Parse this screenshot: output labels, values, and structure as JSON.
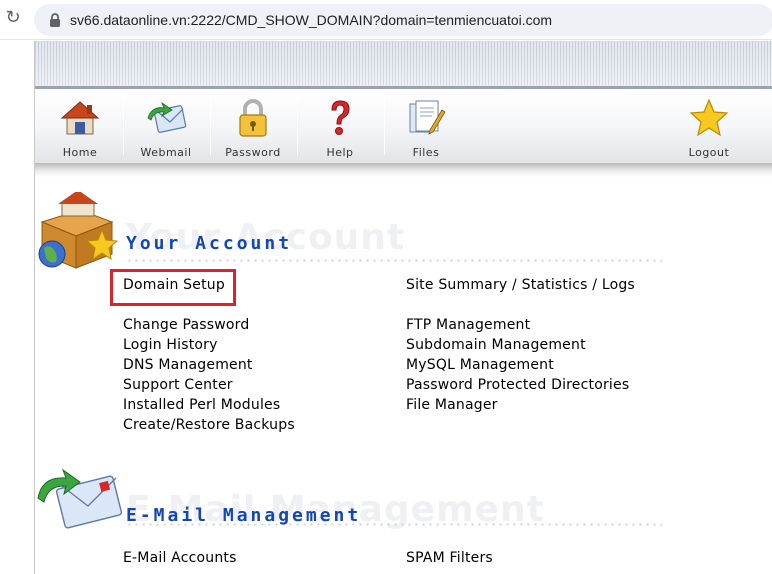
{
  "browser": {
    "url": "sv66.dataonline.vn:2222/CMD_SHOW_DOMAIN?domain=tenmiencuatoi.com"
  },
  "toolbar": {
    "items": [
      {
        "label": "Home",
        "icon": "home-icon"
      },
      {
        "label": "Webmail",
        "icon": "webmail-icon"
      },
      {
        "label": "Password",
        "icon": "padlock-icon"
      },
      {
        "label": "Help",
        "icon": "question-mark-icon"
      },
      {
        "label": "Files",
        "icon": "files-icon"
      },
      {
        "label": "Logout",
        "icon": "star-icon"
      }
    ]
  },
  "account": {
    "title": "Your Account",
    "ghost": "Your Account",
    "icon": "account-box-icon",
    "left_links": [
      "Domain Setup",
      "Change Password",
      "Login History",
      "DNS Management",
      "Support Center",
      "Installed Perl Modules",
      "Create/Restore Backups"
    ],
    "right_links": [
      "Site Summary / Statistics / Logs",
      "FTP Management",
      "Subdomain Management",
      "MySQL Management",
      "Password Protected Directories",
      "File Manager"
    ]
  },
  "email": {
    "title": "E-Mail Management",
    "ghost": "E-Mail Management",
    "icon": "email-envelope-icon",
    "left_links": [
      "E-Mail Accounts"
    ],
    "right_links": [
      "SPAM Filters"
    ]
  },
  "colors": {
    "section_title": "#1446b8",
    "highlight": "#e0202a"
  }
}
